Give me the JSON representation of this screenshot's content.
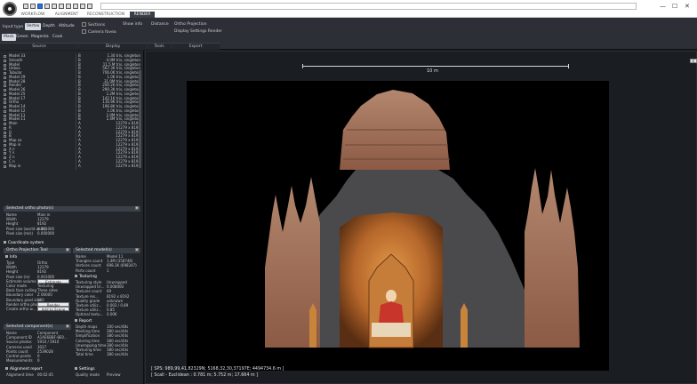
{
  "window": {
    "title": "",
    "tabs": [
      "WORKFLOW",
      "ALIGNMENT",
      "RECONSTRUCTION",
      "RENDER"
    ],
    "active_tab": 3,
    "controls": [
      "—",
      "☐",
      "✕"
    ]
  },
  "ribbon": {
    "input_type_label": "Input type",
    "input_types": [
      "Vertex",
      "Depth",
      "Altitude"
    ],
    "active_input_type": 0,
    "clip_buttons": [
      "Mask",
      "Green",
      "Magenta",
      "Cook"
    ],
    "active_clip": 0,
    "checks": [
      "Sections",
      "Camera fovea"
    ],
    "display_items": [
      "Show info",
      "Distance"
    ],
    "orthographic": "Ortho Projection",
    "display_settings": "Display Settings Render",
    "groups": [
      "Source",
      "Display",
      "Tools",
      "Export"
    ]
  },
  "layer_list": {
    "rows": [
      {
        "name": "Model 33",
        "c2": "B",
        "c3": "",
        "val": "1.30 tris, singleton"
      },
      {
        "name": "Smooth",
        "c2": "B",
        "c3": "",
        "val": "4.0M tris, singleton"
      },
      {
        "name": "Model",
        "c2": "B",
        "c3": "",
        "val": "11.5 M tris, singleton"
      },
      {
        "name": "Unbox",
        "c2": "B",
        "c3": "",
        "val": "567.3K tris, singleton"
      },
      {
        "name": "Tubular",
        "c2": "B",
        "c3": "",
        "val": "706.0K tris, singleton"
      },
      {
        "name": "Model 29",
        "c2": "B",
        "c3": "",
        "val": "1.0K tris, singleton"
      },
      {
        "name": "Model 28",
        "c2": "B",
        "c3": "",
        "val": "31.0M tris, singleton"
      },
      {
        "name": "Render",
        "c2": "B",
        "c3": "",
        "val": "200.2K tris, singleton"
      },
      {
        "name": "Model 26",
        "c2": "B",
        "c3": "",
        "val": "290.3K tris, singleton"
      },
      {
        "name": "Model 25",
        "c2": "B",
        "c3": "",
        "val": "1.2M tris, singleton"
      },
      {
        "name": "Model 17",
        "c2": "B",
        "c3": "",
        "val": "142.1K tris, singleton"
      },
      {
        "name": "Ortho",
        "c2": "B",
        "c3": "",
        "val": "116.9K tris, singleton"
      },
      {
        "name": "Model 14",
        "c2": "B",
        "c3": "",
        "val": "196.8K tris, singleton"
      },
      {
        "name": "Model 12",
        "c2": "B",
        "c3": "",
        "val": "1.0K tris, singleton"
      },
      {
        "name": "Model 11",
        "c2": "B",
        "c3": "",
        "val": "1.0M tris, singleton"
      },
      {
        "name": "Model 11",
        "c2": "B",
        "c3": "",
        "val": "1.4M tris, singleton"
      },
      {
        "name": "Main",
        "c2": "A",
        "c3": "",
        "val": "12279 x 8192"
      },
      {
        "name": "R",
        "c2": "A",
        "c3": "",
        "val": "12279 x 8192"
      },
      {
        "name": "G",
        "c2": "A",
        "c3": "",
        "val": "12279 x 8192"
      },
      {
        "name": "B",
        "c2": "A",
        "c3": "",
        "val": "12279 x 8192"
      },
      {
        "name": "Map xx",
        "c2": "A",
        "c3": "",
        "val": "12279 x 8192"
      },
      {
        "name": "Map in",
        "c2": "A",
        "c3": "",
        "val": "12279 x 8192"
      },
      {
        "name": "X n",
        "c2": "A",
        "c3": "",
        "val": "12279 x 8192"
      },
      {
        "name": "Y n",
        "c2": "A",
        "c3": "",
        "val": "12279 x 8192"
      },
      {
        "name": "Z n",
        "c2": "A",
        "c3": "",
        "val": "12279 x 8192"
      },
      {
        "name": "C n",
        "c2": "A",
        "c3": "",
        "val": "12279 x 8192"
      },
      {
        "name": "Map in",
        "c2": "A",
        "c3": "",
        "val": "12279 x 8192"
      }
    ]
  },
  "selected_ortho": {
    "header": "Selected ortho photo(s)",
    "rows": [
      {
        "k": "Name",
        "v": "Main in"
      },
      {
        "k": "Width",
        "v": "12279"
      },
      {
        "k": "Height",
        "v": "8192"
      },
      {
        "k": "Pixel size (world units)",
        "v": "0.001000"
      },
      {
        "k": "Pixel size (m/s)",
        "v": "0.000000"
      }
    ],
    "coord_label": "Coordinate system"
  },
  "ortho_tool": {
    "header": "Ortho Projection Tool",
    "rows": [
      {
        "k": "Type",
        "v": "Ortho"
      },
      {
        "k": "Width",
        "v": "12279"
      },
      {
        "k": "Height",
        "v": "8192"
      },
      {
        "k": "Pixel size (m)",
        "v": "0.001000"
      },
      {
        "k": "Estimate volume",
        "v": "Estimate"
      },
      {
        "k": "Color mode",
        "v": "Texturing"
      },
      {
        "k": "Back face culling",
        "v": "Three sides"
      },
      {
        "k": "Boundary color",
        "v": "Z   00000"
      },
      {
        "k": "Boundary pixel size",
        "v": "100"
      },
      {
        "k": "Render ortho photo",
        "v": "Render"
      },
      {
        "k": "Create ortho w...",
        "v": "Add to Scene"
      }
    ],
    "section": "Info"
  },
  "selected_models": {
    "header": "Selected model(s)",
    "rows": [
      {
        "k": "Name",
        "v": "Model 11"
      },
      {
        "k": "Triangles count",
        "v": "1,4M (358746)"
      },
      {
        "k": "Vertices count",
        "v": "698.3K (698347)"
      },
      {
        "k": "Parts count",
        "v": "1"
      }
    ],
    "section_texturing": "Texturing",
    "tex_rows": [
      {
        "k": "Texturing style",
        "v": "Unwrapped"
      },
      {
        "k": "Unwrapped tri...",
        "v": "0.008000"
      },
      {
        "k": "Textures count",
        "v": "69"
      },
      {
        "k": "Texture res...",
        "v": "8192 x 8192"
      },
      {
        "k": "Quality grade",
        "v": "unknown"
      },
      {
        "k": "Texture utiliz...",
        "v": "0.003 / 0.89"
      },
      {
        "k": "Texture utiliz...",
        "v": "0.85"
      },
      {
        "k": "Optimal textu...",
        "v": "0.006"
      }
    ],
    "section_report": "Report",
    "report_rows": [
      {
        "k": "Depth maps",
        "v": "100 sec/48s"
      },
      {
        "k": "Meshing time",
        "v": "380 sec/44s"
      },
      {
        "k": "Simplification",
        "v": "380 sec/44s"
      },
      {
        "k": "Coloring time",
        "v": "380 sec/44s"
      },
      {
        "k": "Unwrapping time",
        "v": "380 sec/44s"
      },
      {
        "k": "Texturing time",
        "v": "380 sec/44s"
      },
      {
        "k": "Total time",
        "v": "380 sec/44s"
      }
    ],
    "section_settings": "Settings",
    "settings_rows": [
      {
        "k": "Quality mode",
        "v": "Preview"
      }
    ]
  },
  "selected_components": {
    "header": "Selected component(s)",
    "rows": [
      {
        "k": "Name",
        "v": "Component"
      },
      {
        "k": "Component ID",
        "v": "A1AE6BBF-8E0..."
      },
      {
        "k": "Source photos",
        "v": "5910 / 5910"
      },
      {
        "k": "Cameras used",
        "v": "3027"
      },
      {
        "k": "Points count",
        "v": "2539028"
      },
      {
        "k": "Control points",
        "v": "0"
      },
      {
        "k": "Measurements",
        "v": "0"
      }
    ],
    "section": "Alignment report",
    "report_rows": [
      {
        "k": "Alignment time",
        "v": "00:02:45"
      }
    ]
  },
  "viewport": {
    "scale_label": "10 m",
    "button_label": "⊟",
    "status_line1": "[ SPS: 989,99,41,82329N; 5168,32,30,37197E; 4494734.6 m ]",
    "status_line2": "[ Scall - Euclidean : 0.781 m; 5.752 m; 17.664 m ]"
  },
  "colors": {
    "accent": "#2b6fd6",
    "panel_bg": "#23272c",
    "header_bg": "#3a4149",
    "stone": "#c4846a",
    "section_gray": "#4a4a4c",
    "interior": "#b5662a"
  }
}
